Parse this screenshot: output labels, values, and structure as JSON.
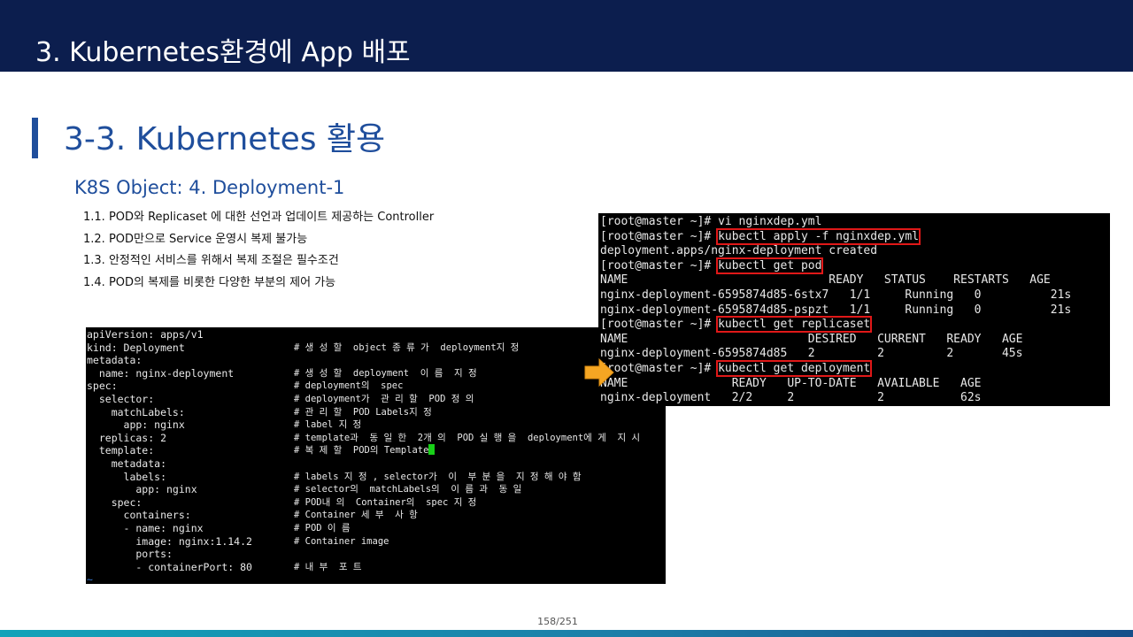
{
  "header": {
    "section_title": "3.  Kubernetes환경에 App 배포"
  },
  "slide": {
    "heading": "3-3. Kubernetes 활용",
    "subheading": "K8S Object: 4. Deployment-1",
    "bullets": [
      "1.1. POD와 Replicaset 에 대한 선언과 업데이트 제공하는 Controller",
      "1.2. POD만으로 Service 운영시 복제 불가능",
      "1.3. 안정적인 서비스를 위해서 복제 조절은 필수조건",
      "1.4. POD의 복제를 비롯한 다양한 부분의 제어 가능"
    ]
  },
  "yaml_terminal": {
    "lines": [
      {
        "code": "apiVersion: apps/v1",
        "comment": ""
      },
      {
        "code": "kind: Deployment",
        "comment": "# 생 성 할  object 종 류 가  deployment지 정"
      },
      {
        "code": "metadata:",
        "comment": ""
      },
      {
        "code": "  name: nginx-deployment",
        "comment": "# 생 성 할  deployment  이 름  지 정"
      },
      {
        "code": "spec:",
        "comment": "# deployment의  spec"
      },
      {
        "code": "  selector:",
        "comment": "# deployment가  관 리 할  POD 정 의"
      },
      {
        "code": "    matchLabels:",
        "comment": "# 관 리 할  POD Labels지 정"
      },
      {
        "code": "      app: nginx",
        "comment": "# label 지 정"
      },
      {
        "code": "  replicas: 2",
        "comment": "# template과  동 일 한  2개 의  POD 실 행 을  deployment에 게  지 시"
      },
      {
        "code": "  template:",
        "comment": "# 복 제 할  POD의 Template"
      },
      {
        "code": "    metadata:",
        "comment": ""
      },
      {
        "code": "      labels:",
        "comment": "# labels 지 정 , selector가  이  부 분 을  지 정 해 야 함"
      },
      {
        "code": "        app: nginx",
        "comment": "# selector의  matchLabels의  이 름 과  동 일"
      },
      {
        "code": "    spec:",
        "comment": "# POD내 의  Container의  spec 지 정"
      },
      {
        "code": "      containers:",
        "comment": "# Container 세 부  사 항"
      },
      {
        "code": "      - name: nginx",
        "comment": "# POD 이 름"
      },
      {
        "code": "        image: nginx:1.14.2",
        "comment": "# Container image"
      },
      {
        "code": "        ports:",
        "comment": ""
      },
      {
        "code": "        - containerPort: 80",
        "comment": "# 내 부  포 트"
      }
    ],
    "tilde": "~"
  },
  "output_terminal": {
    "prompt": "[root@master ~]# ",
    "cmd_vi": "vi nginxdep.yml",
    "cmd_apply": "kubectl apply -f nginxdep.yml",
    "apply_result": "deployment.apps/nginx-deployment created",
    "cmd_get_pod": "kubectl get pod",
    "pod_header": "NAME                             READY   STATUS    RESTARTS   AGE",
    "pod_row_1": "nginx-deployment-6595874d85-6stx7   1/1     Running   0          21s",
    "pod_row_2": "nginx-deployment-6595874d85-pspzt   1/1     Running   0          21s",
    "cmd_get_rs": "kubectl get replicaset",
    "rs_header": "NAME                          DESIRED   CURRENT   READY   AGE",
    "rs_row": "nginx-deployment-6595874d85   2         2         2       45s",
    "cmd_get_deploy": "kubectl get deployment",
    "deploy_header": "NAME               READY   UP-TO-DATE   AVAILABLE   AGE",
    "deploy_row": "nginx-deployment   2/2     2            2           62s"
  },
  "footer": {
    "page_number": "158/251"
  },
  "colors": {
    "header_bg": "#0c1e4e",
    "accent": "#1f4e9c",
    "highlight_box": "#e01818",
    "arrow": "#f5a623",
    "cursor": "#18d018"
  },
  "icons": {
    "pointer": "right-arrow-icon"
  }
}
